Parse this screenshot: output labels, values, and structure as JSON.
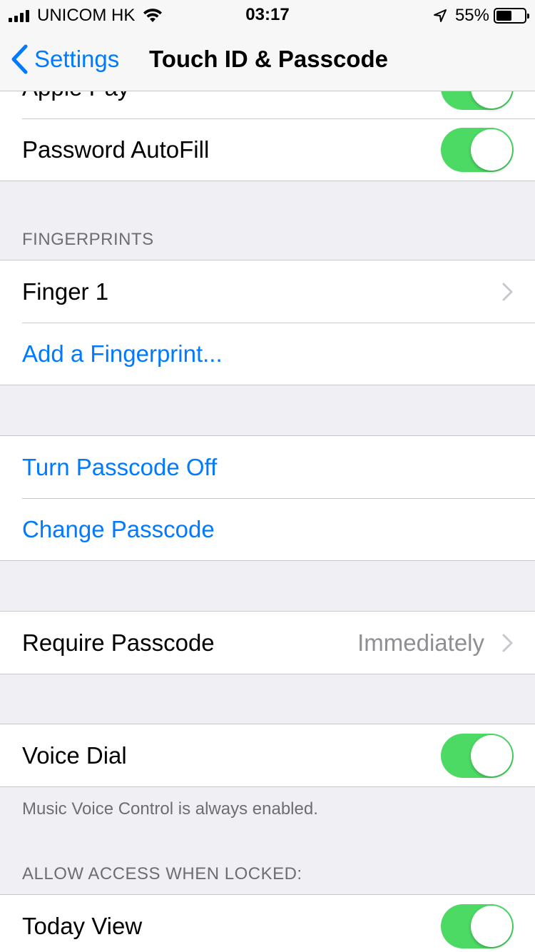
{
  "status_bar": {
    "carrier": "UNICOM HK",
    "time": "03:17",
    "battery_percent": "55%",
    "battery_level": 0.55,
    "icons": [
      "signal-icon",
      "wifi-icon",
      "location-arrow-icon",
      "battery-icon"
    ]
  },
  "nav": {
    "back_label": "Settings",
    "title": "Touch ID & Passcode"
  },
  "top_group": {
    "rows": [
      {
        "label": "Apple Pay",
        "toggle": true
      },
      {
        "label": "Password AutoFill",
        "toggle": true
      }
    ]
  },
  "fingerprints": {
    "header": "FINGERPRINTS",
    "finger_label": "Finger 1",
    "add_label": "Add a Fingerprint..."
  },
  "passcode": {
    "turn_off_label": "Turn Passcode Off",
    "change_label": "Change Passcode"
  },
  "require": {
    "label": "Require Passcode",
    "value": "Immediately"
  },
  "voice": {
    "label": "Voice Dial",
    "toggle": true,
    "footer": "Music Voice Control is always enabled."
  },
  "locked": {
    "header": "ALLOW ACCESS WHEN LOCKED:",
    "today_label": "Today View",
    "toggle": true
  },
  "colors": {
    "accent": "#007aff",
    "toggle_on": "#4cd964",
    "background": "#efeff4"
  }
}
